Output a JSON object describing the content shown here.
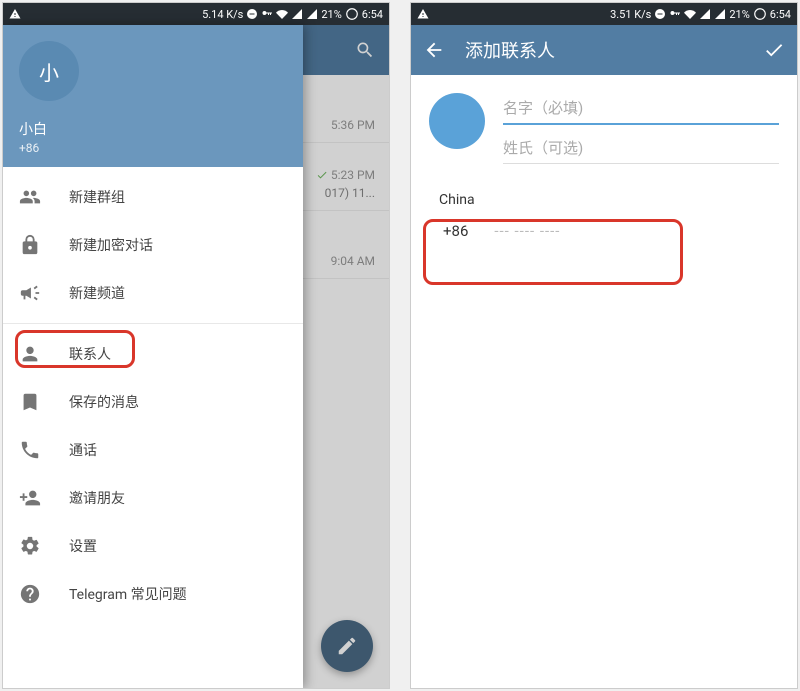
{
  "status": {
    "left_speed": "5.14 K/s",
    "right_speed": "3.51 K/s",
    "battery": "21%",
    "time": "6:54"
  },
  "drawer": {
    "avatar_initial": "小",
    "user_name": "小白",
    "user_phone": "+86",
    "menu": {
      "new_group": "新建群组",
      "new_secret": "新建加密对话",
      "new_channel": "新建频道",
      "contacts": "联系人",
      "saved": "保存的消息",
      "calls": "通话",
      "invite": "邀请朋友",
      "settings": "设置",
      "faq": "Telegram 常见问题"
    }
  },
  "chats": {
    "time1": "5:36 PM",
    "time2": "5:23 PM",
    "snip2": "017) 11...",
    "time3": "9:04 AM"
  },
  "add": {
    "title": "添加联系人",
    "first_name_ph": "名字（必填)",
    "last_name_ph": "姓氏（可选)",
    "country": "China",
    "cc": "+86",
    "phone_ph": "--- ---- ----"
  }
}
